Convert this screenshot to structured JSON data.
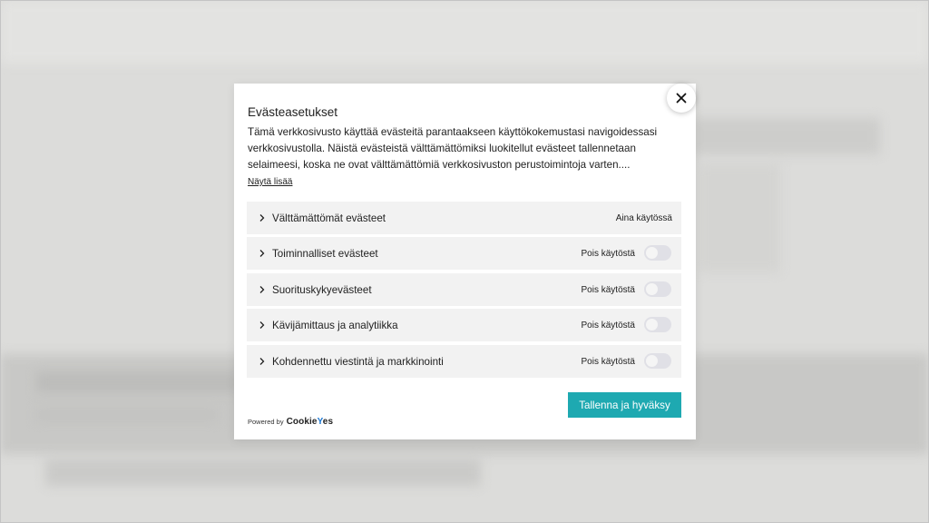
{
  "dialog": {
    "title": "Evästeasetukset",
    "description": "Tämä verkkosivusto käyttää evästeitä parantaakseen käyttökokemustasi navigoidessasi verkkosivustolla. Näistä evästeistä välttämättömiksi luokitellut evästeet tallennetaan selaimeesi, koska ne ovat välttämättömiä verkkosivuston perustoimintoja varten....",
    "show_more_label": "Näytä lisää",
    "close_icon": "close-icon"
  },
  "categories": [
    {
      "label": "Välttämättömät evästeet",
      "status": "Aina käytössä",
      "toggle": null
    },
    {
      "label": "Toiminnalliset evästeet",
      "status": "Pois käytöstä",
      "toggle": false
    },
    {
      "label": "Suorituskykyevästeet",
      "status": "Pois käytöstä",
      "toggle": false
    },
    {
      "label": "Kävijämittaus ja analytiikka",
      "status": "Pois käytöstä",
      "toggle": false
    },
    {
      "label": "Kohdennettu viestintä ja markkinointi",
      "status": "Pois käytöstä",
      "toggle": false
    }
  ],
  "footer": {
    "save_label": "Tallenna ja hyväksy",
    "powered_by": "Powered by",
    "brand_prefix": "Cookie",
    "brand_accent": "Y",
    "brand_suffix": "es"
  },
  "colors": {
    "accent": "#1ea9b1",
    "brand_accent": "#1976d2",
    "row_bg": "#f2f2f2",
    "toggle_off": "#e0e0e6"
  }
}
